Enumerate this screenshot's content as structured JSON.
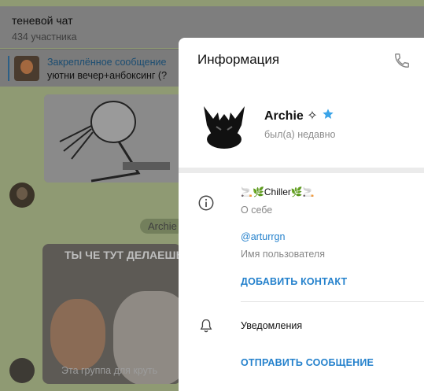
{
  "chat": {
    "title": "теневой чат",
    "members": "434 участника",
    "pinned_title": "Закреплённое сообщение",
    "pinned_text": "уютни вечер+анбоксинг (?",
    "sender_chip": "Archie",
    "photo_caption": "ТЫ ЧЕ ТУТ ДЕЛАЕШЬ",
    "photo_bottom": "Эта группа для круть"
  },
  "panel": {
    "title": "Информация",
    "name": "Archie",
    "name_symbol": "✧",
    "status": "был(а) недавно",
    "bio": "🚬🌿Chiller🌿🚬",
    "bio_label": "О себе",
    "username": "@arturrgn",
    "username_label": "Имя пользователя",
    "add_contact": "ДОБАВИТЬ КОНТАКТ",
    "notifications": "Уведомления",
    "send_message": "ОТПРАВИТЬ СООБЩЕНИЕ"
  },
  "icons": {
    "phone": "phone-icon",
    "star": "star-icon",
    "info": "info-icon",
    "bell": "bell-icon"
  },
  "colors": {
    "accent": "#2481cc",
    "panel_bg": "#ebebeb",
    "overlay": "#7d7d7d"
  }
}
